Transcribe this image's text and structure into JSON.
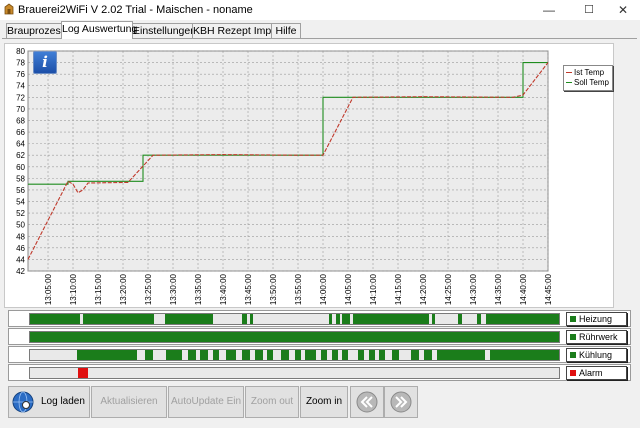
{
  "window": {
    "title": "Brauerei2WiFi V 2.02 Trial - Maischen - noname",
    "minimize": "—",
    "maximize": "☐",
    "close": "✕"
  },
  "tabs": [
    {
      "label": "Brauprozess",
      "active": false
    },
    {
      "label": "Log Auswertung",
      "active": true
    },
    {
      "label": "Einstellungen",
      "active": false
    },
    {
      "label": "KBH Rezept Import",
      "active": false
    },
    {
      "label": "Hilfe",
      "active": false
    }
  ],
  "info_button": {
    "label": "i"
  },
  "chart_data": {
    "type": "line",
    "ylim": [
      42,
      80
    ],
    "y_ticks": [
      "80",
      "78",
      "76",
      "74",
      "72",
      "70",
      "68",
      "66",
      "64",
      "62",
      "60",
      "58",
      "56",
      "54",
      "52",
      "50",
      "48",
      "46",
      "44",
      "42"
    ],
    "x_ticks": [
      "13:05:00",
      "13:10:00",
      "13:15:00",
      "13:20:00",
      "13:25:00",
      "13:30:00",
      "13:35:00",
      "13:40:00",
      "13:45:00",
      "13:50:00",
      "13:55:00",
      "14:00:00",
      "14:05:00",
      "14:10:00",
      "14:15:00",
      "14:20:00",
      "14:25:00",
      "14:30:00",
      "14:35:00",
      "14:40:00",
      "14:45:00"
    ],
    "x_start": "13:01:00",
    "x_end": "14:45:00",
    "grid": true,
    "legend": "right",
    "series": [
      {
        "name": "Ist Temp",
        "color": "#c0392b",
        "points": [
          [
            "13:01:00",
            44
          ],
          [
            "13:09:00",
            57.5
          ],
          [
            "13:10:00",
            57
          ],
          [
            "13:11:00",
            55.5
          ],
          [
            "13:12:00",
            56
          ],
          [
            "13:13:00",
            57.2
          ],
          [
            "13:21:00",
            57.3
          ],
          [
            "13:26:00",
            62
          ],
          [
            "13:40:00",
            62.1
          ],
          [
            "13:55:00",
            62
          ],
          [
            "14:00:00",
            62
          ],
          [
            "14:06:00",
            72
          ],
          [
            "14:20:00",
            72.1
          ],
          [
            "14:38:00",
            72
          ],
          [
            "14:40:00",
            72.4
          ],
          [
            "14:45:00",
            78
          ]
        ]
      },
      {
        "name": "Soll Temp",
        "color": "#1e8c1e",
        "points": [
          [
            "13:01:00",
            57
          ],
          [
            "13:09:00",
            57
          ],
          [
            "13:09:00",
            57.5
          ],
          [
            "13:24:00",
            57.5
          ],
          [
            "13:24:00",
            62
          ],
          [
            "14:00:00",
            62
          ],
          [
            "14:00:00",
            72
          ],
          [
            "14:40:00",
            72
          ],
          [
            "14:40:00",
            78
          ],
          [
            "14:45:00",
            78
          ]
        ]
      }
    ]
  },
  "status_bars": [
    {
      "label": "Heizung",
      "color": "#1b7d1b",
      "segments": [
        [
          0,
          0.095
        ],
        [
          0.1,
          0.115
        ],
        [
          0.215,
          0.02
        ],
        [
          0.255,
          0.09
        ],
        [
          0.4,
          0.01
        ],
        [
          0.415,
          0.006
        ],
        [
          0.565,
          0.005
        ],
        [
          0.578,
          0.008
        ],
        [
          0.59,
          0.01
        ],
        [
          0.6,
          0.005
        ],
        [
          0.61,
          0.145
        ],
        [
          0.76,
          0.006
        ],
        [
          0.81,
          0.006
        ],
        [
          0.845,
          0.008
        ],
        [
          0.862,
          0.14
        ]
      ]
    },
    {
      "label": "Rührwerk",
      "color": "#1b7d1b",
      "segments": [
        [
          0,
          1
        ]
      ]
    },
    {
      "label": "Kühlung",
      "color": "#1b7d1b",
      "segments": [
        [
          0.088,
          0.115
        ],
        [
          0.218,
          0.015
        ],
        [
          0.258,
          0.03
        ],
        [
          0.298,
          0.015
        ],
        [
          0.322,
          0.015
        ],
        [
          0.345,
          0.012
        ],
        [
          0.37,
          0.02
        ],
        [
          0.4,
          0.015
        ],
        [
          0.425,
          0.015
        ],
        [
          0.448,
          0.012
        ],
        [
          0.475,
          0.015
        ],
        [
          0.5,
          0.012
        ],
        [
          0.52,
          0.02
        ],
        [
          0.55,
          0.012
        ],
        [
          0.57,
          0.012
        ],
        [
          0.59,
          0.012
        ],
        [
          0.62,
          0.012
        ],
        [
          0.64,
          0.012
        ],
        [
          0.66,
          0.012
        ],
        [
          0.685,
          0.012
        ],
        [
          0.72,
          0.015
        ],
        [
          0.745,
          0.015
        ],
        [
          0.77,
          0.09
        ],
        [
          0.87,
          0.13
        ]
      ]
    },
    {
      "label": "Alarm",
      "color": "#e01010",
      "segments": [
        [
          0.09,
          0.02
        ]
      ]
    }
  ],
  "toolbar": {
    "log_laden": "Log laden",
    "aktualisieren": "Aktualisieren",
    "autoupdate": "AutoUpdate Ein",
    "zoom_out": "Zoom out",
    "zoom_in": "Zoom in"
  },
  "colors": {
    "heat_on": "#1b7d1b",
    "alarm": "#e01010"
  }
}
